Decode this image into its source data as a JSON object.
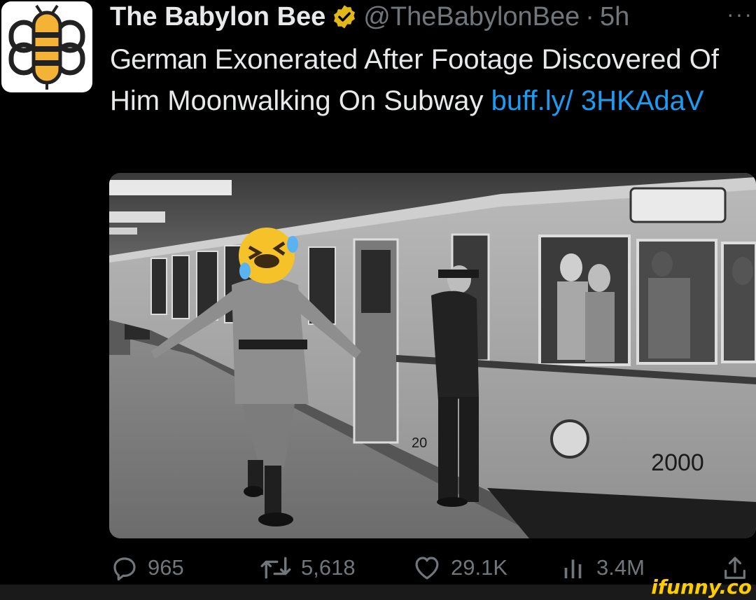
{
  "account": {
    "name": "The Babylon Bee",
    "handle": "@TheBabylonBee",
    "separator": "·",
    "time": "5h",
    "more": "···"
  },
  "tweet": {
    "text_lead": "German",
    "text_rest": " Exonerated After Footage Discovered Of Him Moonwalking On Subway ",
    "link": "buff.ly/ 3HKAdaV"
  },
  "media": {
    "train_number": "2000",
    "side_number": "20"
  },
  "actions": {
    "replies": "965",
    "reposts": "5,618",
    "likes": "29.1K",
    "views": "3.4M"
  },
  "watermark": "ifunny.co",
  "colors": {
    "background": "#000000",
    "text": "#e7e9ea",
    "muted": "#71767b",
    "link": "#1d9bf0",
    "verified": "#e2b719",
    "bee_yellow": "#f5b335"
  }
}
